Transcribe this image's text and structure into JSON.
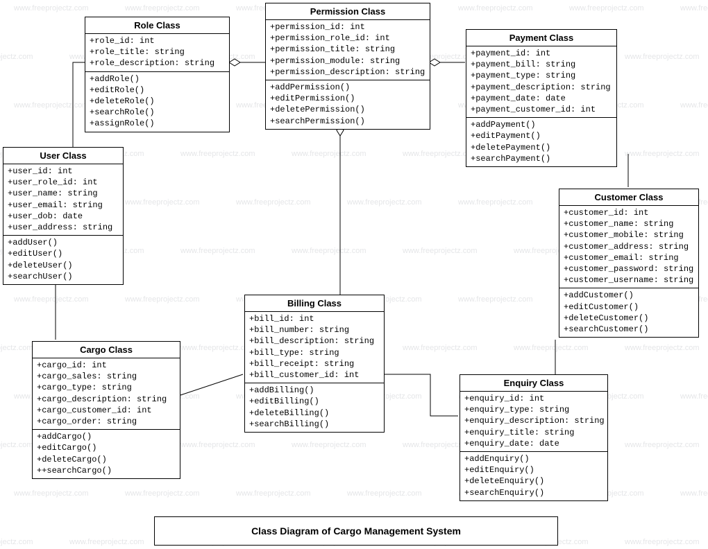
{
  "title": "Class Diagram of Cargo Management System",
  "watermark_text": "www.freeprojectz.com",
  "classes": {
    "role": {
      "name": "Role Class",
      "attributes": [
        "+role_id: int",
        "+role_title: string",
        "+role_description: string"
      ],
      "methods": [
        "+addRole()",
        "+editRole()",
        "+deleteRole()",
        "+searchRole()",
        "+assignRole()"
      ]
    },
    "permission": {
      "name": "Permission Class",
      "attributes": [
        "+permission_id: int",
        "+permission_role_id: int",
        "+permission_title: string",
        "+permission_module: string",
        "+permission_description: string"
      ],
      "methods": [
        "+addPermission()",
        "+editPermission()",
        "+deletePermission()",
        "+searchPermission()"
      ]
    },
    "payment": {
      "name": "Payment Class",
      "attributes": [
        "+payment_id: int",
        "+payment_bill: string",
        "+payment_type: string",
        "+payment_description: string",
        "+payment_date: date",
        "+payment_customer_id: int"
      ],
      "methods": [
        "+addPayment()",
        "+editPayment()",
        "+deletePayment()",
        "+searchPayment()"
      ]
    },
    "user": {
      "name": "User Class",
      "attributes": [
        "+user_id: int",
        "+user_role_id: int",
        "+user_name: string",
        "+user_email: string",
        "+user_dob: date",
        "+user_address: string"
      ],
      "methods": [
        "+addUser()",
        "+editUser()",
        "+deleteUser()",
        "+searchUser()"
      ]
    },
    "customer": {
      "name": "Customer Class",
      "attributes": [
        "+customer_id: int",
        "+customer_name: string",
        "+customer_mobile: string",
        "+customer_address: string",
        "+customer_email: string",
        "+customer_password: string",
        "+customer_username: string"
      ],
      "methods": [
        "+addCustomer()",
        "+editCustomer()",
        "+deleteCustomer()",
        "+searchCustomer()"
      ]
    },
    "billing": {
      "name": "Billing Class",
      "attributes": [
        "+bill_id: int",
        "+bill_number: string",
        "+bill_description: string",
        "+bill_type: string",
        "+bill_receipt: string",
        "+bill_customer_id: int"
      ],
      "methods": [
        "+addBilling()",
        "+editBilling()",
        "+deleteBilling()",
        "+searchBilling()"
      ]
    },
    "cargo": {
      "name": "Cargo Class",
      "attributes": [
        "+cargo_id: int",
        "+cargo_sales: string",
        "+cargo_type: string",
        "+cargo_description: string",
        "+cargo_customer_id: int",
        "+cargo_order: string"
      ],
      "methods": [
        "+addCargo()",
        "+editCargo()",
        "+deleteCargo()",
        "++searchCargo()"
      ]
    },
    "enquiry": {
      "name": "Enquiry Class",
      "attributes": [
        "+enquiry_id: int",
        "+enquiry_type: string",
        "+enquiry_description: string",
        "+enquiry_title: string",
        "+enquiry_date: date"
      ],
      "methods": [
        "+addEnquiry()",
        "+editEnquiry()",
        "+deleteEnquiry()",
        "+searchEnquiry()"
      ]
    }
  }
}
